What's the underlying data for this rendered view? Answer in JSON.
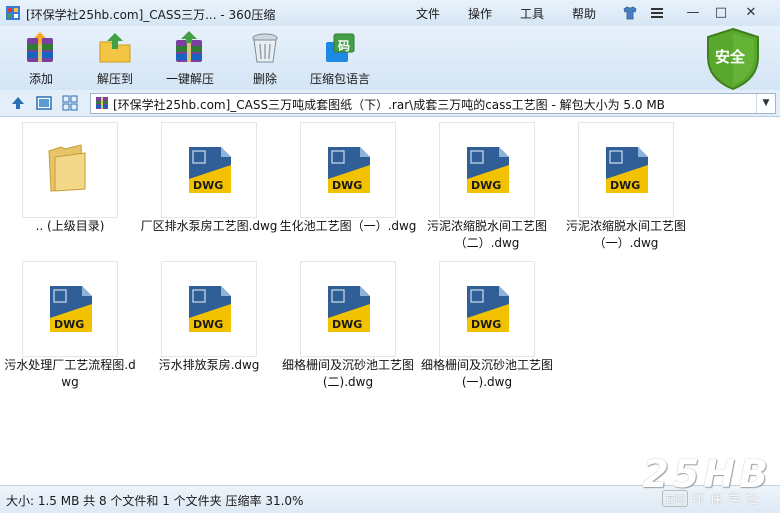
{
  "window": {
    "title": "[环保学社25hb.com]_CASS三万... - 360压缩",
    "menu": [
      "文件",
      "操作",
      "工具",
      "帮助"
    ],
    "controls": [
      "—",
      "□",
      "✕"
    ]
  },
  "toolbar": {
    "items": [
      {
        "label": "添加",
        "icon": "add-archive-icon"
      },
      {
        "label": "解压到",
        "icon": "extract-to-icon"
      },
      {
        "label": "一键解压",
        "icon": "one-click-extract-icon"
      },
      {
        "label": "删除",
        "icon": "trash-icon"
      },
      {
        "label": "压缩包语言",
        "icon": "archive-language-icon"
      }
    ],
    "language_badge": "码",
    "security_badge": "安全"
  },
  "address": {
    "path": "[环保学社25hb.com]_CASS三万吨成套图纸（下）.rar\\成套三万吨的cass工艺图 - 解包大小为 5.0 MB"
  },
  "files": [
    {
      "name": ".. (上级目录)",
      "type": "folder"
    },
    {
      "name": "厂区排水泵房工艺图.dwg",
      "type": "dwg"
    },
    {
      "name": "生化池工艺图（一）.dwg",
      "type": "dwg"
    },
    {
      "name": "污泥浓缩脱水间工艺图（二）.dwg",
      "type": "dwg"
    },
    {
      "name": "污泥浓缩脱水间工艺图（一）.dwg",
      "type": "dwg"
    },
    {
      "name": "污水处理厂工艺流程图.dwg",
      "type": "dwg"
    },
    {
      "name": "污水排放泵房.dwg",
      "type": "dwg"
    },
    {
      "name": "细格栅间及沉砂池工艺图(二).dwg",
      "type": "dwg"
    },
    {
      "name": "细格栅间及沉砂池工艺图(一).dwg",
      "type": "dwg"
    }
  ],
  "dwg_label": "DWG",
  "status": "大小: 1.5 MB 共 8 个文件和 1 个文件夹 压缩率 31.0%",
  "watermark": {
    "big": "25HB",
    "tag": "官网",
    "small": "环保学社"
  },
  "colors": {
    "accent": "#2a6fb5",
    "shield": "#5aa72e",
    "dwg_yellow": "#f2c200"
  }
}
